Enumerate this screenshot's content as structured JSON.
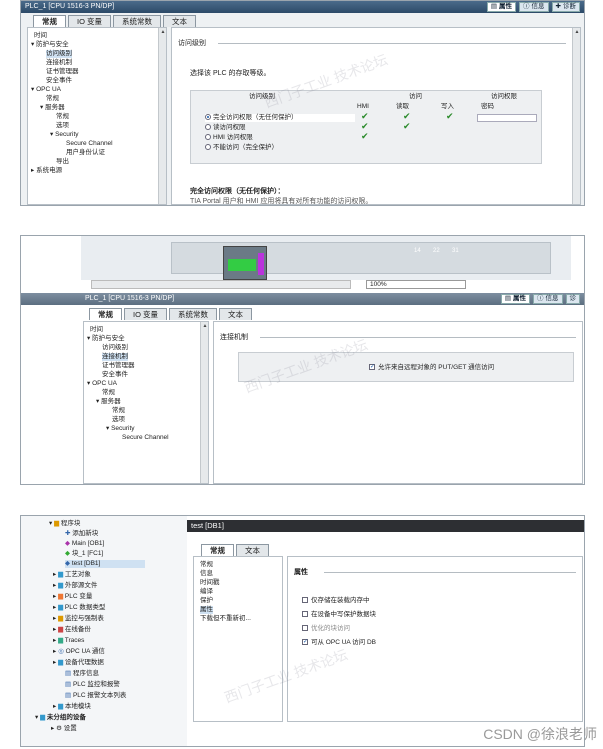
{
  "panel1": {
    "title": "PLC_1 [CPU 1516-3 PN/DP]",
    "top_tabs": [
      "属性",
      "信息",
      "诊断"
    ],
    "tabs": [
      "常规",
      "IO 变量",
      "系统常数",
      "文本"
    ],
    "tree": [
      "时间",
      "防护与安全",
      "访问级别",
      "连接机制",
      "证书管理器",
      "安全事件",
      "OPC UA",
      "常规",
      "服务器",
      "常规",
      "选项",
      "Security",
      "Secure Channel",
      "用户身份认证",
      "导出",
      "系统电源"
    ],
    "section_title": "访问级别",
    "select_text": "选择该 PLC 的存取等级。",
    "table_headers": {
      "level": "访问级别",
      "access": "访问",
      "permission": "访问权限",
      "hmi": "HMI",
      "read": "读取",
      "write": "写入",
      "password": "密码"
    },
    "rows": [
      "完全访问权限（无任何保护）",
      "读访问权限",
      "HMI 访问权限",
      "不能访问（完全保护）"
    ],
    "footer_title": "完全访问权限（无任何保护）：",
    "footer_text": "TIA Portal 用户和 HMI 应用将具有对所有功能的访问权限。"
  },
  "panel2": {
    "module_numbers": [
      "14",
      "22",
      "31"
    ],
    "zoom": "100%",
    "title": "PLC_1 [CPU 1516-3 PN/DP]",
    "top_tabs": [
      "属性",
      "信息",
      "诊"
    ],
    "tabs": [
      "常规",
      "IO 变量",
      "系统常数",
      "文本"
    ],
    "tree": [
      "时间",
      "防护与安全",
      "访问级别",
      "连接机制",
      "证书管理器",
      "安全事件",
      "OPC UA",
      "常规",
      "服务器",
      "常规",
      "选项",
      "Security",
      "Secure Channel"
    ],
    "section_title": "连接机制",
    "checkbox_label": "允许来自远程对象的 PUT/GET 通信访问"
  },
  "panel3": {
    "project_tree": [
      "程序块",
      "添加新块",
      "Main [OB1]",
      "块_1 [FC1]",
      "test [DB1]",
      "工艺对象",
      "外部源文件",
      "PLC 变量",
      "PLC 数据类型",
      "监控与强制表",
      "在线备份",
      "Traces",
      "OPC UA 通信",
      "设备代理数据",
      "程序信息",
      "PLC 监控和报警",
      "PLC 报警文本列表",
      "本地模块",
      "未分组的设备",
      "设置"
    ],
    "title": "test [DB1]",
    "tabs": [
      "常规",
      "文本"
    ],
    "nav": [
      "常规",
      "信息",
      "时间戳",
      "编译",
      "保护",
      "属性",
      "下载但不重新初..."
    ],
    "section_title": "属性",
    "checkboxes": [
      {
        "label": "仅存储在装载内存中",
        "checked": false
      },
      {
        "label": "在设备中写保护数据块",
        "checked": false
      },
      {
        "label": "优化的块访问",
        "checked": false
      },
      {
        "label": "可从 OPC UA 访问 DB",
        "checked": true
      }
    ]
  },
  "watermark": "西门子工业 技术论坛",
  "credit": "CSDN @徐浪老师"
}
